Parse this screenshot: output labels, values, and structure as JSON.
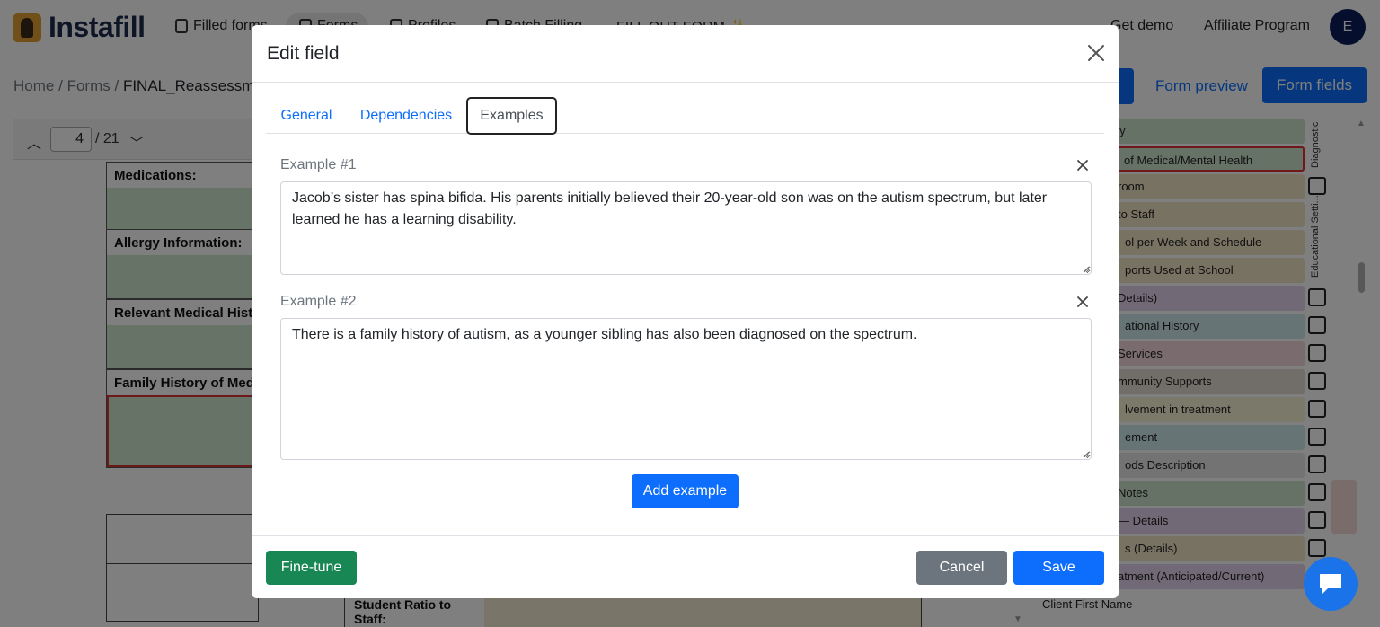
{
  "app": {
    "name": "Instafill",
    "nav": [
      "Filled forms",
      "Forms",
      "Profiles",
      "Batch Filling",
      "FILL OUT FORM ✨"
    ],
    "right_links": [
      "Get demo",
      "Affiliate Program"
    ],
    "avatar_letter": "E"
  },
  "breadcrumb": {
    "items": [
      "Home",
      "Forms",
      "FINAL_Reassessm"
    ],
    "sep": "/"
  },
  "toolbar": {
    "form_preview": "Form preview",
    "form_fields": "Form fields"
  },
  "pager": {
    "current": "4",
    "total": "/ 21"
  },
  "document": {
    "sections": [
      "Medications:",
      "Allergy Information:",
      "Relevant Medical Hist",
      "Family History of Med"
    ],
    "student_ratio_label": "Student Ratio to Staff:"
  },
  "sidebar": {
    "rows": [
      "cal History",
      "of Medical/Mental Health",
      "room",
      "to Staff",
      "ol per Week and Schedule",
      "ports Used at School",
      "Details)",
      "ational History",
      "Services",
      "mmunity Supports",
      "lvement in treatment",
      "ement",
      "ods Description",
      "Notes",
      "— Details",
      "s (Details)",
      "atment (Anticipated/Current)",
      "Client First Name"
    ],
    "group_labels": [
      "Diagnostic",
      "Educational Setti..."
    ]
  },
  "modal": {
    "title": "Edit field",
    "tabs": [
      "General",
      "Dependencies",
      "Examples"
    ],
    "active_tab": "Examples",
    "examples": [
      {
        "label": "Example #1",
        "text": "Jacob’s sister has spina bifida. His parents initially believed their 20-year-old son was on the autism spectrum, but later learned he has a learning disability."
      },
      {
        "label": "Example #2",
        "text": "There is a family history of autism, as a younger sibling has also been diagnosed on the spectrum."
      }
    ],
    "add_example": "Add example",
    "fine_tune": "Fine-tune",
    "cancel": "Cancel",
    "save": "Save"
  },
  "colors": {
    "primary": "#0d6efd",
    "success": "#198754",
    "secondary": "#6c757d"
  }
}
